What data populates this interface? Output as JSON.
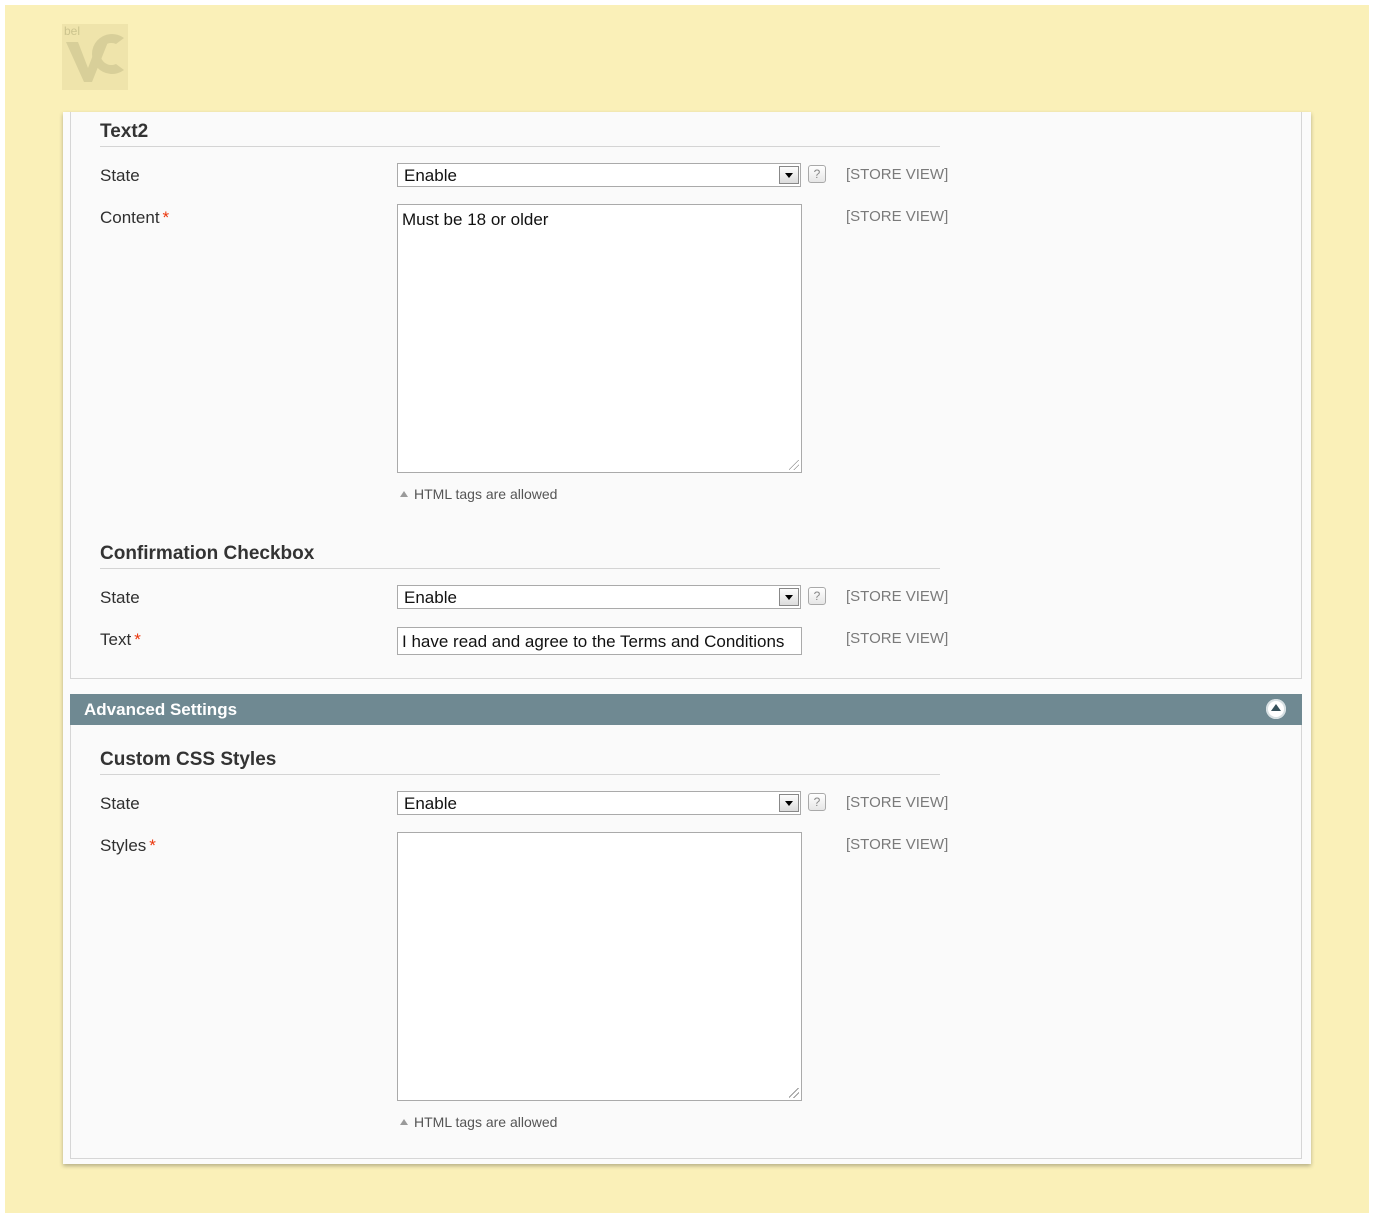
{
  "logo": {
    "text": "bel",
    "colors": {
      "mark": "#d8cf99",
      "text": "#ccc48e"
    }
  },
  "colors": {
    "page_background": "#faf0b8",
    "panel_background": "#fafafa",
    "section_header": "#6f8992",
    "required": "#eb340a"
  },
  "text2_section": {
    "legend": "Text2",
    "state": {
      "label": "State",
      "value": "Enable",
      "help": "?",
      "scope": "[STORE VIEW]"
    },
    "content": {
      "label": "Content",
      "required_mark": "*",
      "value": "Must be 18 or older",
      "scope": "[STORE VIEW]",
      "note": "HTML tags are allowed"
    }
  },
  "confirmation_section": {
    "legend": "Confirmation Checkbox",
    "state": {
      "label": "State",
      "value": "Enable",
      "help": "?",
      "scope": "[STORE VIEW]"
    },
    "text": {
      "label": "Text",
      "required_mark": "*",
      "value": "I have read and agree to the Terms and Conditions",
      "scope": "[STORE VIEW]"
    }
  },
  "advanced": {
    "title": "Advanced Settings",
    "collapse_icon": "collapse-up-icon",
    "custom_css": {
      "legend": "Custom CSS Styles",
      "state": {
        "label": "State",
        "value": "Enable",
        "help": "?",
        "scope": "[STORE VIEW]"
      },
      "styles": {
        "label": "Styles",
        "required_mark": "*",
        "value": "",
        "scope": "[STORE VIEW]",
        "note": "HTML tags are allowed"
      }
    }
  }
}
